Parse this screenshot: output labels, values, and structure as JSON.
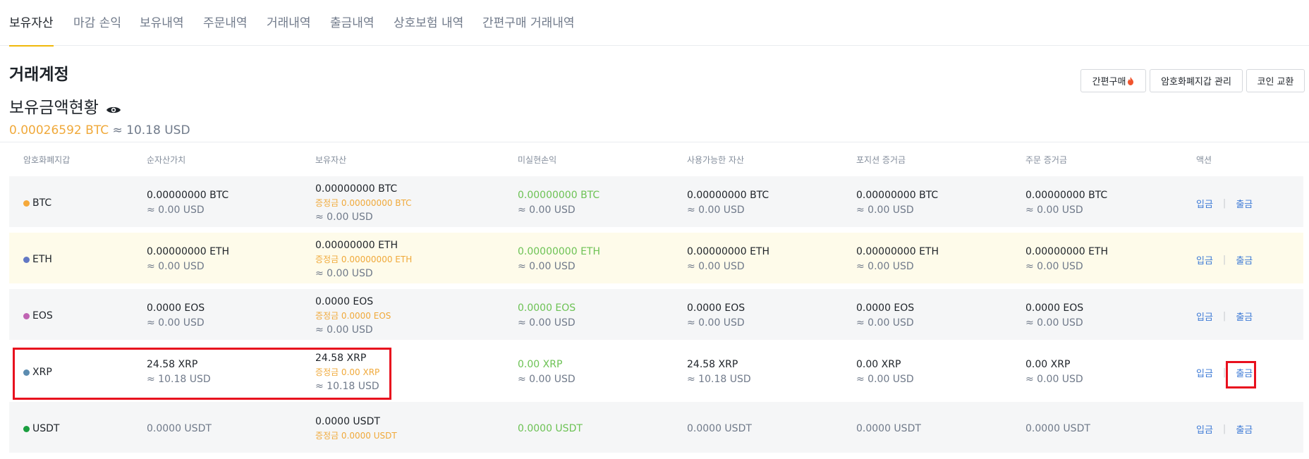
{
  "tabs": [
    {
      "label": "보유자산"
    },
    {
      "label": "마감 손익"
    },
    {
      "label": "보유내역"
    },
    {
      "label": "주문내역"
    },
    {
      "label": "거래내역"
    },
    {
      "label": "출금내역"
    },
    {
      "label": "상호보험 내역"
    },
    {
      "label": "간편구매 거래내역"
    }
  ],
  "section_title": "거래계정",
  "holding_title": "보유금액현황",
  "balance": {
    "btc": "0.00026592 BTC",
    "approx": "≈ 10.18 USD"
  },
  "buttons": {
    "quick_buy": "간편구매",
    "wallet_manage": "암호화폐지갑 관리",
    "coin_exchange": "코인 교환"
  },
  "columns": [
    "암호화폐지갑",
    "순자산가치",
    "보유자산",
    "미실현손익",
    "사용가능한 자산",
    "포지션 증거금",
    "주문 증거금",
    "액션"
  ],
  "rows": [
    {
      "coin": "BTC",
      "dot_color": "#f5a93b",
      "net": "0.00000000 BTC",
      "net_usd": "≈ 0.00 USD",
      "holding": "0.00000000 BTC",
      "bonus": "증정금 0.00000000 BTC",
      "holding_usd": "≈ 0.00 USD",
      "pnl": "0.00000000 BTC",
      "pnl_usd": "≈ 0.00 USD",
      "avail": "0.00000000 BTC",
      "avail_usd": "≈ 0.00 USD",
      "pos": "0.00000000 BTC",
      "pos_usd": "≈ 0.00 USD",
      "order": "0.00000000 BTC",
      "order_usd": "≈ 0.00 USD"
    },
    {
      "coin": "ETH",
      "dot_color": "#6278c4",
      "net": "0.00000000 ETH",
      "net_usd": "≈ 0.00 USD",
      "holding": "0.00000000 ETH",
      "bonus": "증정금 0.00000000 ETH",
      "holding_usd": "≈ 0.00 USD",
      "pnl": "0.00000000 ETH",
      "pnl_usd": "≈ 0.00 USD",
      "avail": "0.00000000 ETH",
      "avail_usd": "≈ 0.00 USD",
      "pos": "0.00000000 ETH",
      "pos_usd": "≈ 0.00 USD",
      "order": "0.00000000 ETH",
      "order_usd": "≈ 0.00 USD"
    },
    {
      "coin": "EOS",
      "dot_color": "#c064b3",
      "net": "0.0000 EOS",
      "net_usd": "≈ 0.00 USD",
      "holding": "0.0000 EOS",
      "bonus": "증정금 0.0000 EOS",
      "holding_usd": "≈ 0.00 USD",
      "pnl": "0.0000 EOS",
      "pnl_usd": "≈ 0.00 USD",
      "avail": "0.0000 EOS",
      "avail_usd": "≈ 0.00 USD",
      "pos": "0.0000 EOS",
      "pos_usd": "≈ 0.00 USD",
      "order": "0.0000 EOS",
      "order_usd": "≈ 0.00 USD"
    },
    {
      "coin": "XRP",
      "dot_color": "#5c8cb0",
      "net": "24.58 XRP",
      "net_usd": "≈ 10.18 USD",
      "holding": "24.58 XRP",
      "bonus": "증정금 0.00 XRP",
      "holding_usd": "≈ 10.18 USD",
      "pnl": "0.00 XRP",
      "pnl_usd": "≈ 0.00 USD",
      "avail": "24.58 XRP",
      "avail_usd": "≈ 10.18 USD",
      "pos": "0.00 XRP",
      "pos_usd": "≈ 0.00 USD",
      "order": "0.00 XRP",
      "order_usd": "≈ 0.00 USD"
    },
    {
      "coin": "USDT",
      "dot_color": "#1a9e3f",
      "net": "0.0000 USDT",
      "holding": "0.0000 USDT",
      "bonus": "증정금 0.0000 USDT",
      "pnl": "0.0000 USDT",
      "avail": "0.0000 USDT",
      "pos": "0.0000 USDT",
      "order": "0.0000 USDT"
    }
  ],
  "actions": {
    "deposit": "입금",
    "withdraw": "출금",
    "separator": "|"
  }
}
